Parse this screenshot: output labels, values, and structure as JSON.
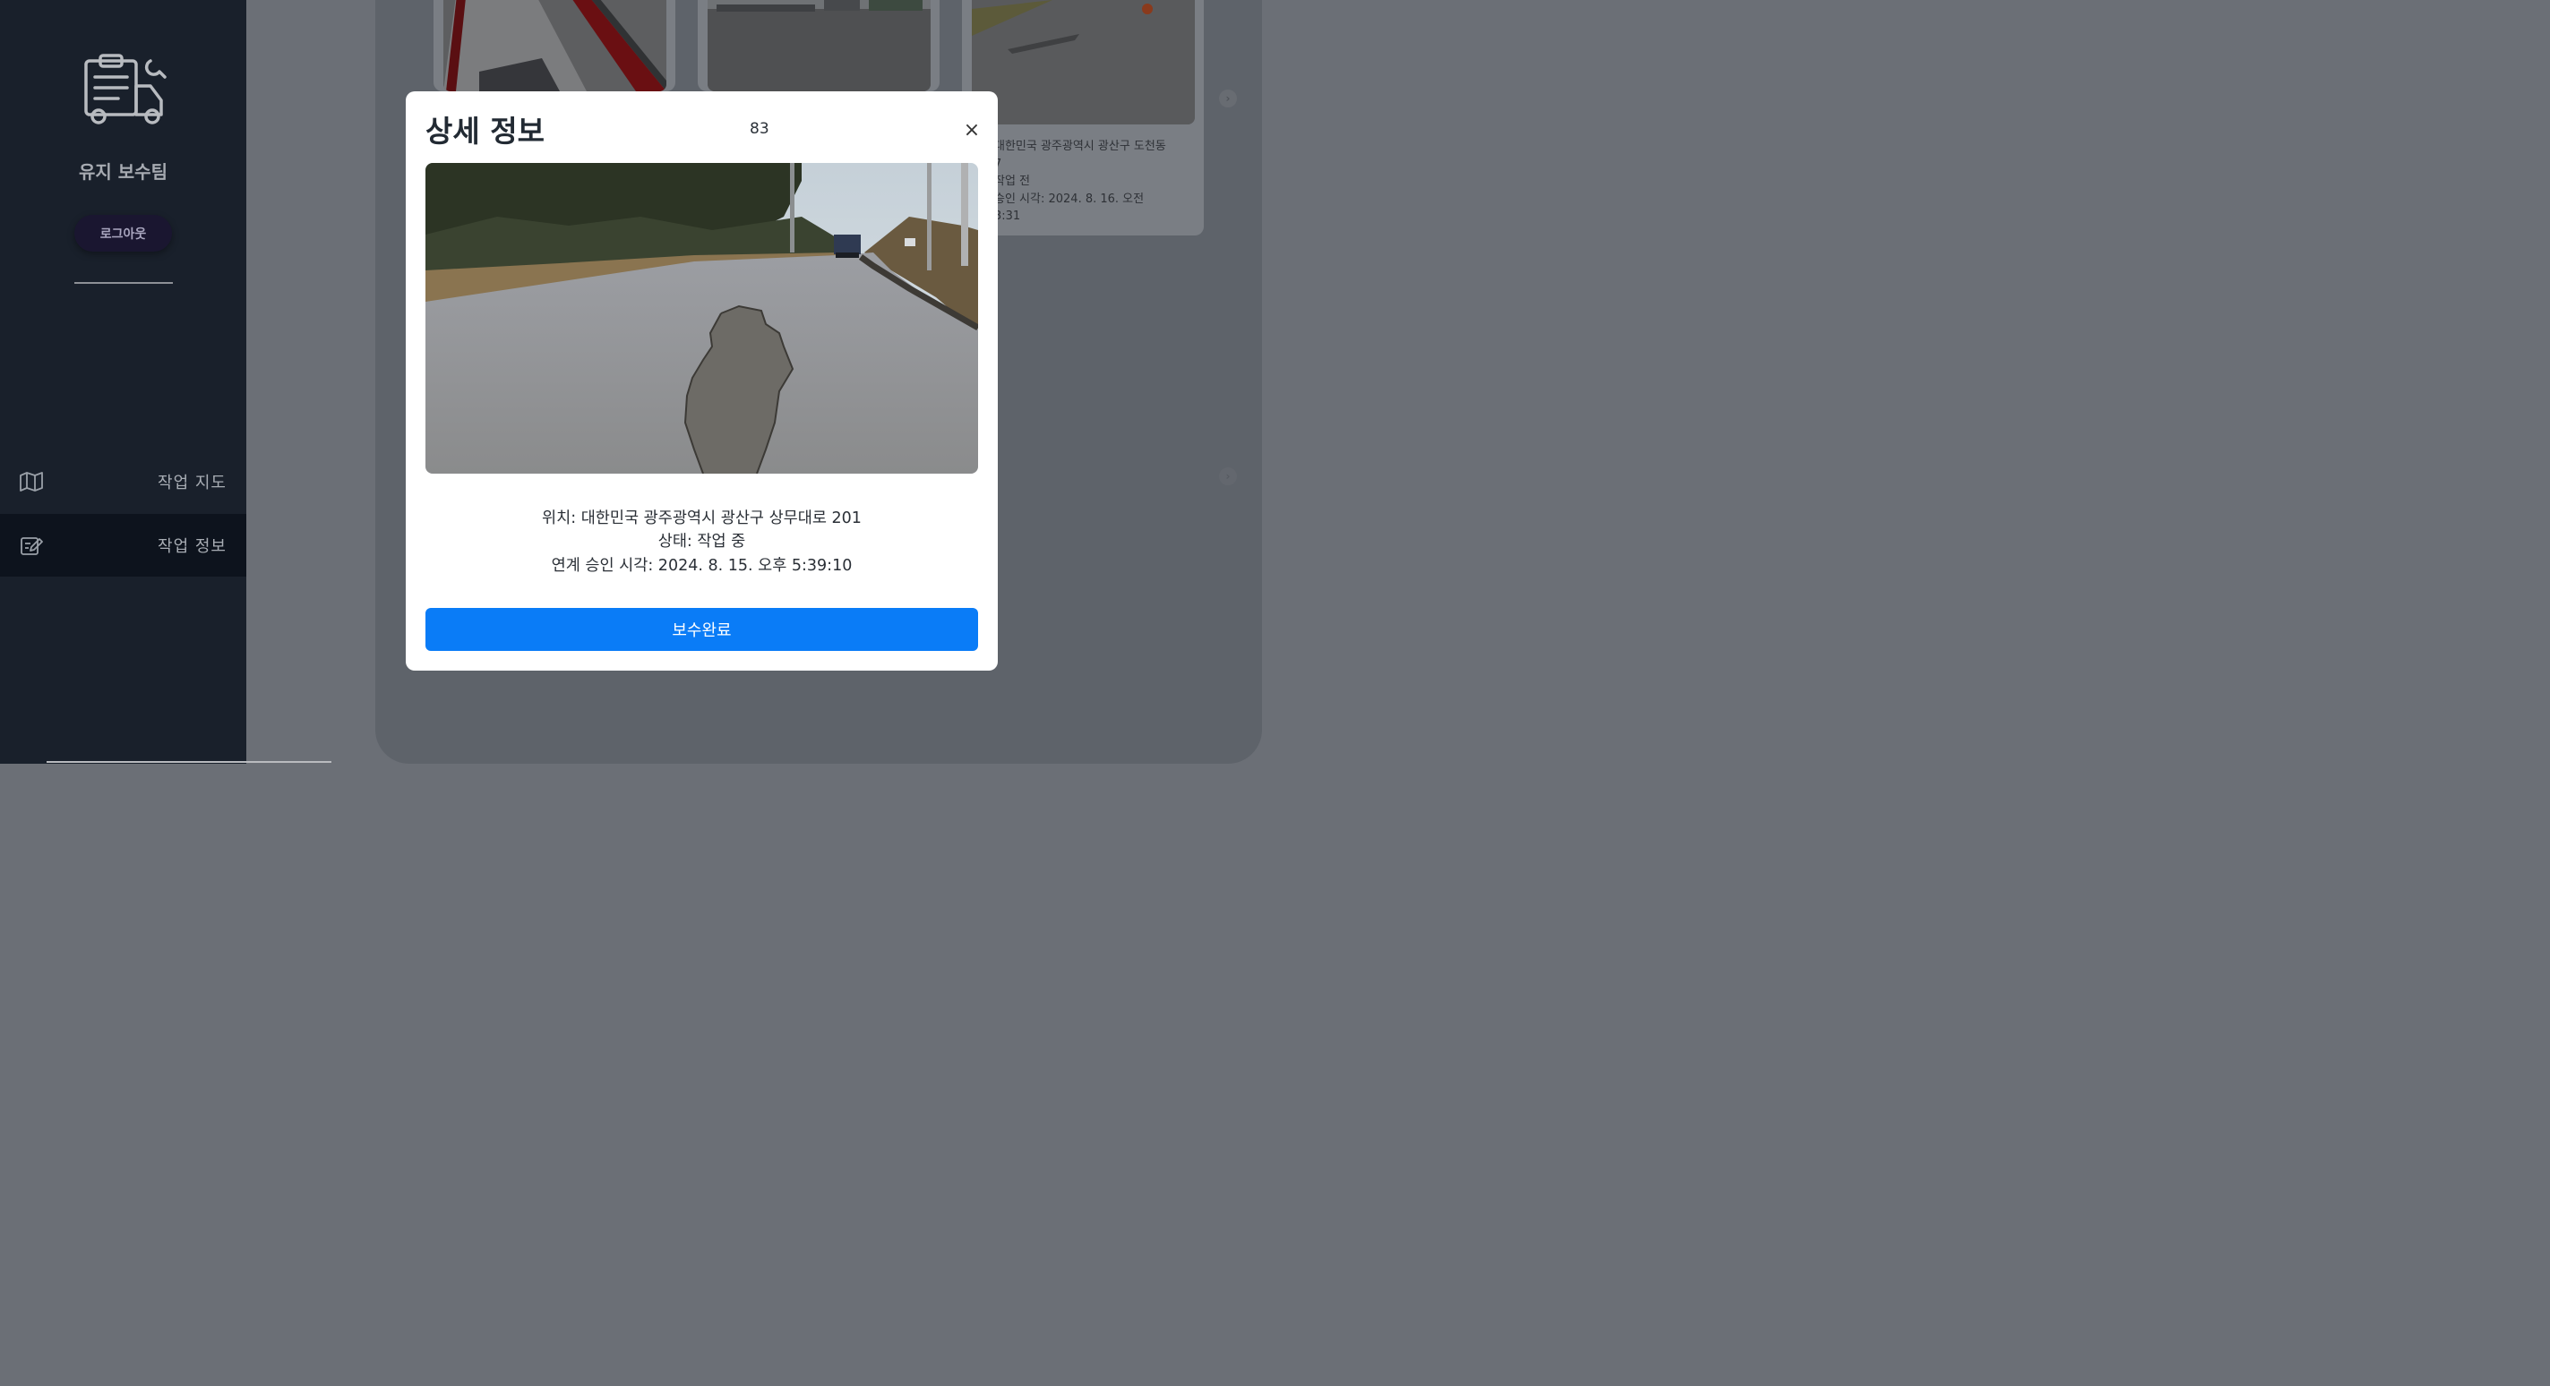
{
  "sidebar": {
    "team_name": "유지 보수팀",
    "logout_label": "로그아웃",
    "nav": [
      {
        "label": "작업 지도",
        "icon": "map-icon",
        "active": false
      },
      {
        "label": "작업 정보",
        "icon": "edit-note-icon",
        "active": true
      }
    ],
    "logo_icon": "clipboard-truck-logo"
  },
  "background_cards": [
    {
      "icon": "road-photo"
    },
    {
      "icon": "road-photo"
    },
    {
      "icon": "road-photo",
      "location": "대한민국 광주광역시 광산구 도천동",
      "location_cont": "7",
      "status": "작업 전",
      "time": "승인 시각: 2024. 8. 16. 오전",
      "time_cont": "3:31"
    }
  ],
  "modal": {
    "title": "상세 정보",
    "id": "83",
    "close_label": "×",
    "location": "위치: 대한민국 광주광역시 광산구 상무대로 201",
    "status": "상태: 작업 중",
    "time": "연계 승인 시각: 2024. 8. 15. 오후 5:39:10",
    "button_label": "보수완료"
  },
  "colors": {
    "sidebar_bg": "#19202b",
    "active_nav_bg": "#0d131d",
    "primary_button": "#0a7cf7",
    "overlay": "#6b6f76"
  }
}
